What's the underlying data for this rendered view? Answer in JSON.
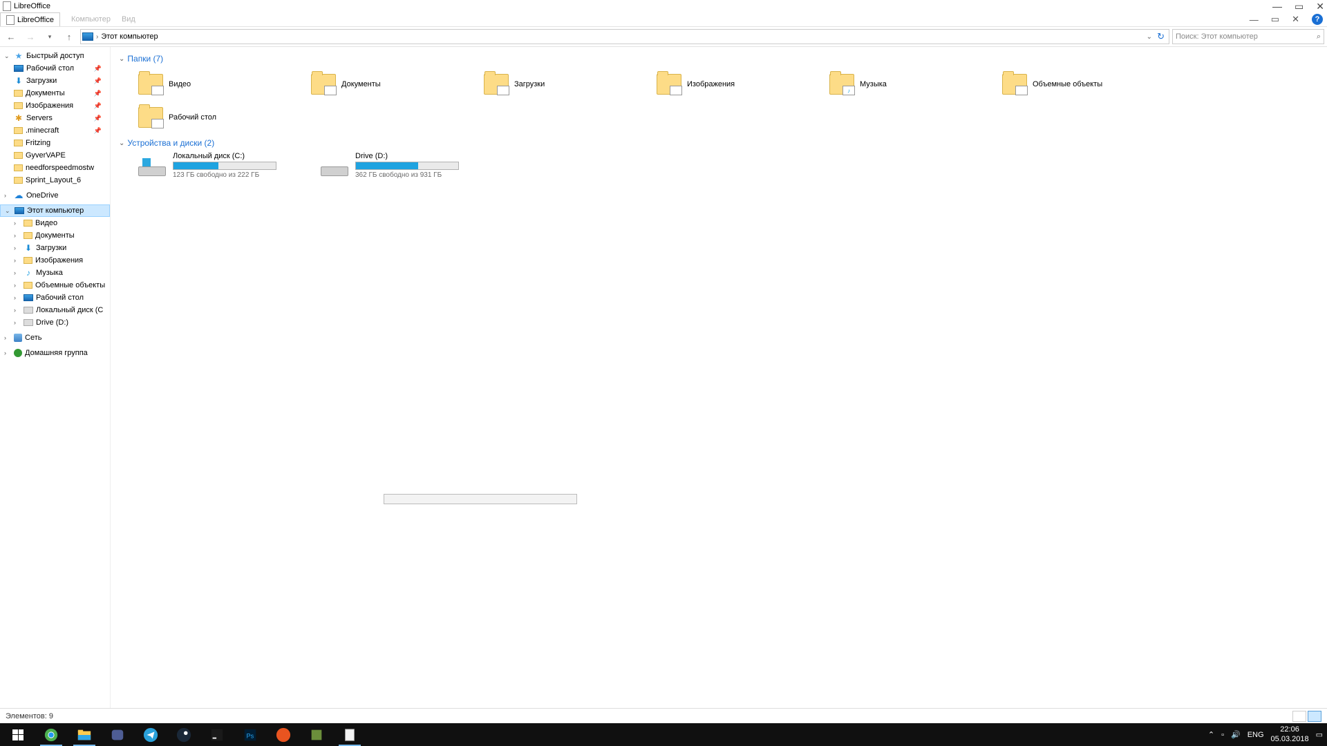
{
  "libreoffice": {
    "title": "LibreOffice"
  },
  "explorer": {
    "tab_title": "LibreOffice",
    "menu_ghost": [
      "Компьютер",
      "Вид"
    ],
    "address": "Этот компьютер",
    "search_placeholder": "Поиск: Этот компьютер",
    "sidebar": {
      "quick_access": "Быстрый доступ",
      "quick_items": [
        {
          "label": "Рабочий стол",
          "pinned": true
        },
        {
          "label": "Загрузки",
          "pinned": true
        },
        {
          "label": "Документы",
          "pinned": true
        },
        {
          "label": "Изображения",
          "pinned": true
        },
        {
          "label": "Servers",
          "pinned": true
        },
        {
          "label": ".minecraft",
          "pinned": true
        },
        {
          "label": "Fritzing"
        },
        {
          "label": "GyverVAPE"
        },
        {
          "label": "needforspeedmostw"
        },
        {
          "label": "Sprint_Layout_6"
        }
      ],
      "onedrive": "OneDrive",
      "this_pc": "Этот компьютер",
      "pc_items": [
        "Видео",
        "Документы",
        "Загрузки",
        "Изображения",
        "Музыка",
        "Объемные объекты",
        "Рабочий стол",
        "Локальный диск (C",
        "Drive (D:)"
      ],
      "network": "Сеть",
      "homegroup": "Домашняя группа"
    },
    "sections": {
      "folders_head": "Папки (7)",
      "folders": [
        "Видео",
        "Документы",
        "Загрузки",
        "Изображения",
        "Музыка",
        "Объемные объекты",
        "Рабочий стол"
      ],
      "drives_head": "Устройства и диски (2)",
      "drives": [
        {
          "name": "Локальный диск (C:)",
          "sub": "123 ГБ свободно из 222 ГБ",
          "fill": 44
        },
        {
          "name": "Drive (D:)",
          "sub": "362 ГБ свободно из 931 ГБ",
          "fill": 61
        }
      ]
    },
    "status": "Элементов: 9"
  },
  "taskbar": {
    "time": "22:06",
    "date": "05.03.2018",
    "lang": "ENG"
  }
}
